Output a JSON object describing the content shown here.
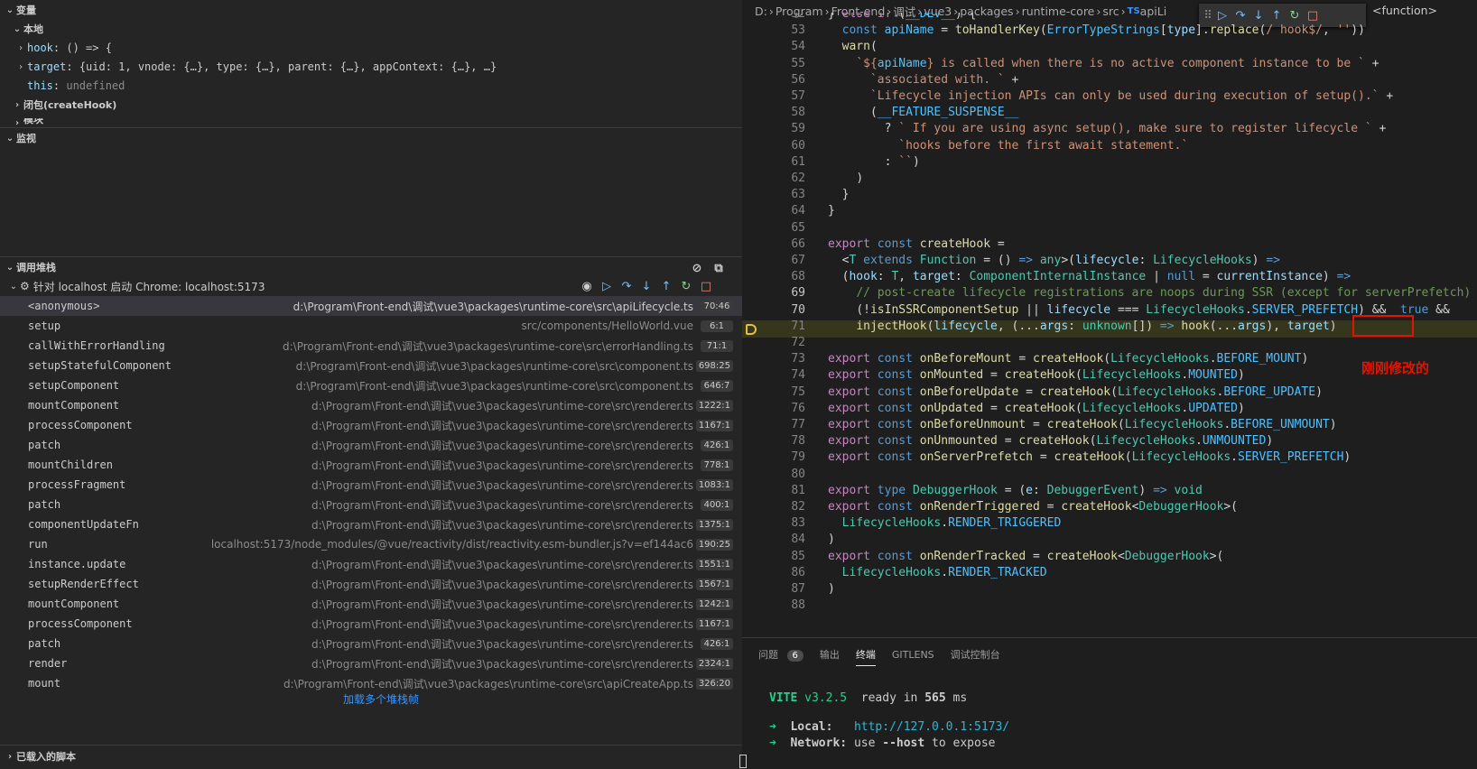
{
  "variables_panel": {
    "title": "变量",
    "local_label": "本地",
    "vars": [
      {
        "name": "hook",
        "value": "() => {"
      },
      {
        "name": "target",
        "value": "{uid: 1, vnode: {…}, type: {…}, parent: {…}, appContext: {…}, …}"
      },
      {
        "name": "this",
        "value": "undefined"
      }
    ],
    "closure_label": "闭包(createHook)",
    "clipped_label": "模块"
  },
  "watch_panel": {
    "title": "监视"
  },
  "callstack_panel": {
    "title": "调用堆栈",
    "session_label": "针对 localhost 启动 Chrome: localhost:5173",
    "frames": [
      {
        "fn": "<anonymous>",
        "path": "d:\\Program\\Front-end\\调试\\vue3\\packages\\runtime-core\\src\\apiLifecycle.ts",
        "loc": "70:46"
      },
      {
        "fn": "setup",
        "path": "src/components/HelloWorld.vue",
        "loc": "6:1"
      },
      {
        "fn": "callWithErrorHandling",
        "path": "d:\\Program\\Front-end\\调试\\vue3\\packages\\runtime-core\\src\\errorHandling.ts",
        "loc": "71:1"
      },
      {
        "fn": "setupStatefulComponent",
        "path": "d:\\Program\\Front-end\\调试\\vue3\\packages\\runtime-core\\src\\component.ts",
        "loc": "698:25"
      },
      {
        "fn": "setupComponent",
        "path": "d:\\Program\\Front-end\\调试\\vue3\\packages\\runtime-core\\src\\component.ts",
        "loc": "646:7"
      },
      {
        "fn": "mountComponent",
        "path": "d:\\Program\\Front-end\\调试\\vue3\\packages\\runtime-core\\src\\renderer.ts",
        "loc": "1222:1"
      },
      {
        "fn": "processComponent",
        "path": "d:\\Program\\Front-end\\调试\\vue3\\packages\\runtime-core\\src\\renderer.ts",
        "loc": "1167:1"
      },
      {
        "fn": "patch",
        "path": "d:\\Program\\Front-end\\调试\\vue3\\packages\\runtime-core\\src\\renderer.ts",
        "loc": "426:1"
      },
      {
        "fn": "mountChildren",
        "path": "d:\\Program\\Front-end\\调试\\vue3\\packages\\runtime-core\\src\\renderer.ts",
        "loc": "778:1"
      },
      {
        "fn": "processFragment",
        "path": "d:\\Program\\Front-end\\调试\\vue3\\packages\\runtime-core\\src\\renderer.ts",
        "loc": "1083:1"
      },
      {
        "fn": "patch",
        "path": "d:\\Program\\Front-end\\调试\\vue3\\packages\\runtime-core\\src\\renderer.ts",
        "loc": "400:1"
      },
      {
        "fn": "componentUpdateFn",
        "path": "d:\\Program\\Front-end\\调试\\vue3\\packages\\runtime-core\\src\\renderer.ts",
        "loc": "1375:1"
      },
      {
        "fn": "run",
        "path": "localhost:5173/node_modules/@vue/reactivity/dist/reactivity.esm-bundler.js?v=ef144ac6",
        "loc": "190:25"
      },
      {
        "fn": "instance.update",
        "path": "d:\\Program\\Front-end\\调试\\vue3\\packages\\runtime-core\\src\\renderer.ts",
        "loc": "1551:1"
      },
      {
        "fn": "setupRenderEffect",
        "path": "d:\\Program\\Front-end\\调试\\vue3\\packages\\runtime-core\\src\\renderer.ts",
        "loc": "1567:1"
      },
      {
        "fn": "mountComponent",
        "path": "d:\\Program\\Front-end\\调试\\vue3\\packages\\runtime-core\\src\\renderer.ts",
        "loc": "1242:1"
      },
      {
        "fn": "processComponent",
        "path": "d:\\Program\\Front-end\\调试\\vue3\\packages\\runtime-core\\src\\renderer.ts",
        "loc": "1167:1"
      },
      {
        "fn": "patch",
        "path": "d:\\Program\\Front-end\\调试\\vue3\\packages\\runtime-core\\src\\renderer.ts",
        "loc": "426:1"
      },
      {
        "fn": "render",
        "path": "d:\\Program\\Front-end\\调试\\vue3\\packages\\runtime-core\\src\\renderer.ts",
        "loc": "2324:1"
      },
      {
        "fn": "mount",
        "path": "d:\\Program\\Front-end\\调试\\vue3\\packages\\runtime-core\\src\\apiCreateApp.ts",
        "loc": "326:20"
      }
    ],
    "load_more": "加载多个堆栈帧"
  },
  "loaded_scripts": {
    "title": "已载入的脚本"
  },
  "breadcrumb": [
    "D:",
    "Program",
    "Front-end",
    "调试",
    "vue3",
    "packages",
    "runtime-core",
    "src",
    "apiLi"
  ],
  "breadcrumb_ts_badge": "TS",
  "breadcrumb_tail": "<function>",
  "editor": {
    "line_numbers": [
      "52",
      "53",
      "54",
      "55",
      "56",
      "57",
      "58",
      "59",
      "60",
      "61",
      "62",
      "63",
      "64",
      "65",
      "66",
      "67",
      "68",
      "69",
      "70",
      "71",
      "72",
      "73",
      "74",
      "75",
      "76",
      "77",
      "78",
      "79",
      "80",
      "81",
      "82",
      "83",
      "84",
      "85",
      "86",
      "87",
      "88"
    ],
    "annotation": "刚刚修改的"
  },
  "panel_tabs": {
    "problems": "问题",
    "problems_count": "6",
    "output": "输出",
    "terminal": "终端",
    "gitlens": "GITLENS",
    "debug_console": "调试控制台"
  },
  "terminal": {
    "vite": "VITE",
    "version": "v3.2.5",
    "ready": "ready in",
    "ms_value": "565",
    "ms_unit": "ms",
    "local_label": "Local:",
    "local_url": "http://127.0.0.1:5173/",
    "network_label": "Network:",
    "network_use": "use",
    "network_flag": "--host",
    "network_rest": "to expose"
  },
  "colors": {
    "accent": "#3794ff",
    "current_line": "#3b3a1e",
    "annotation": "#e51400"
  }
}
